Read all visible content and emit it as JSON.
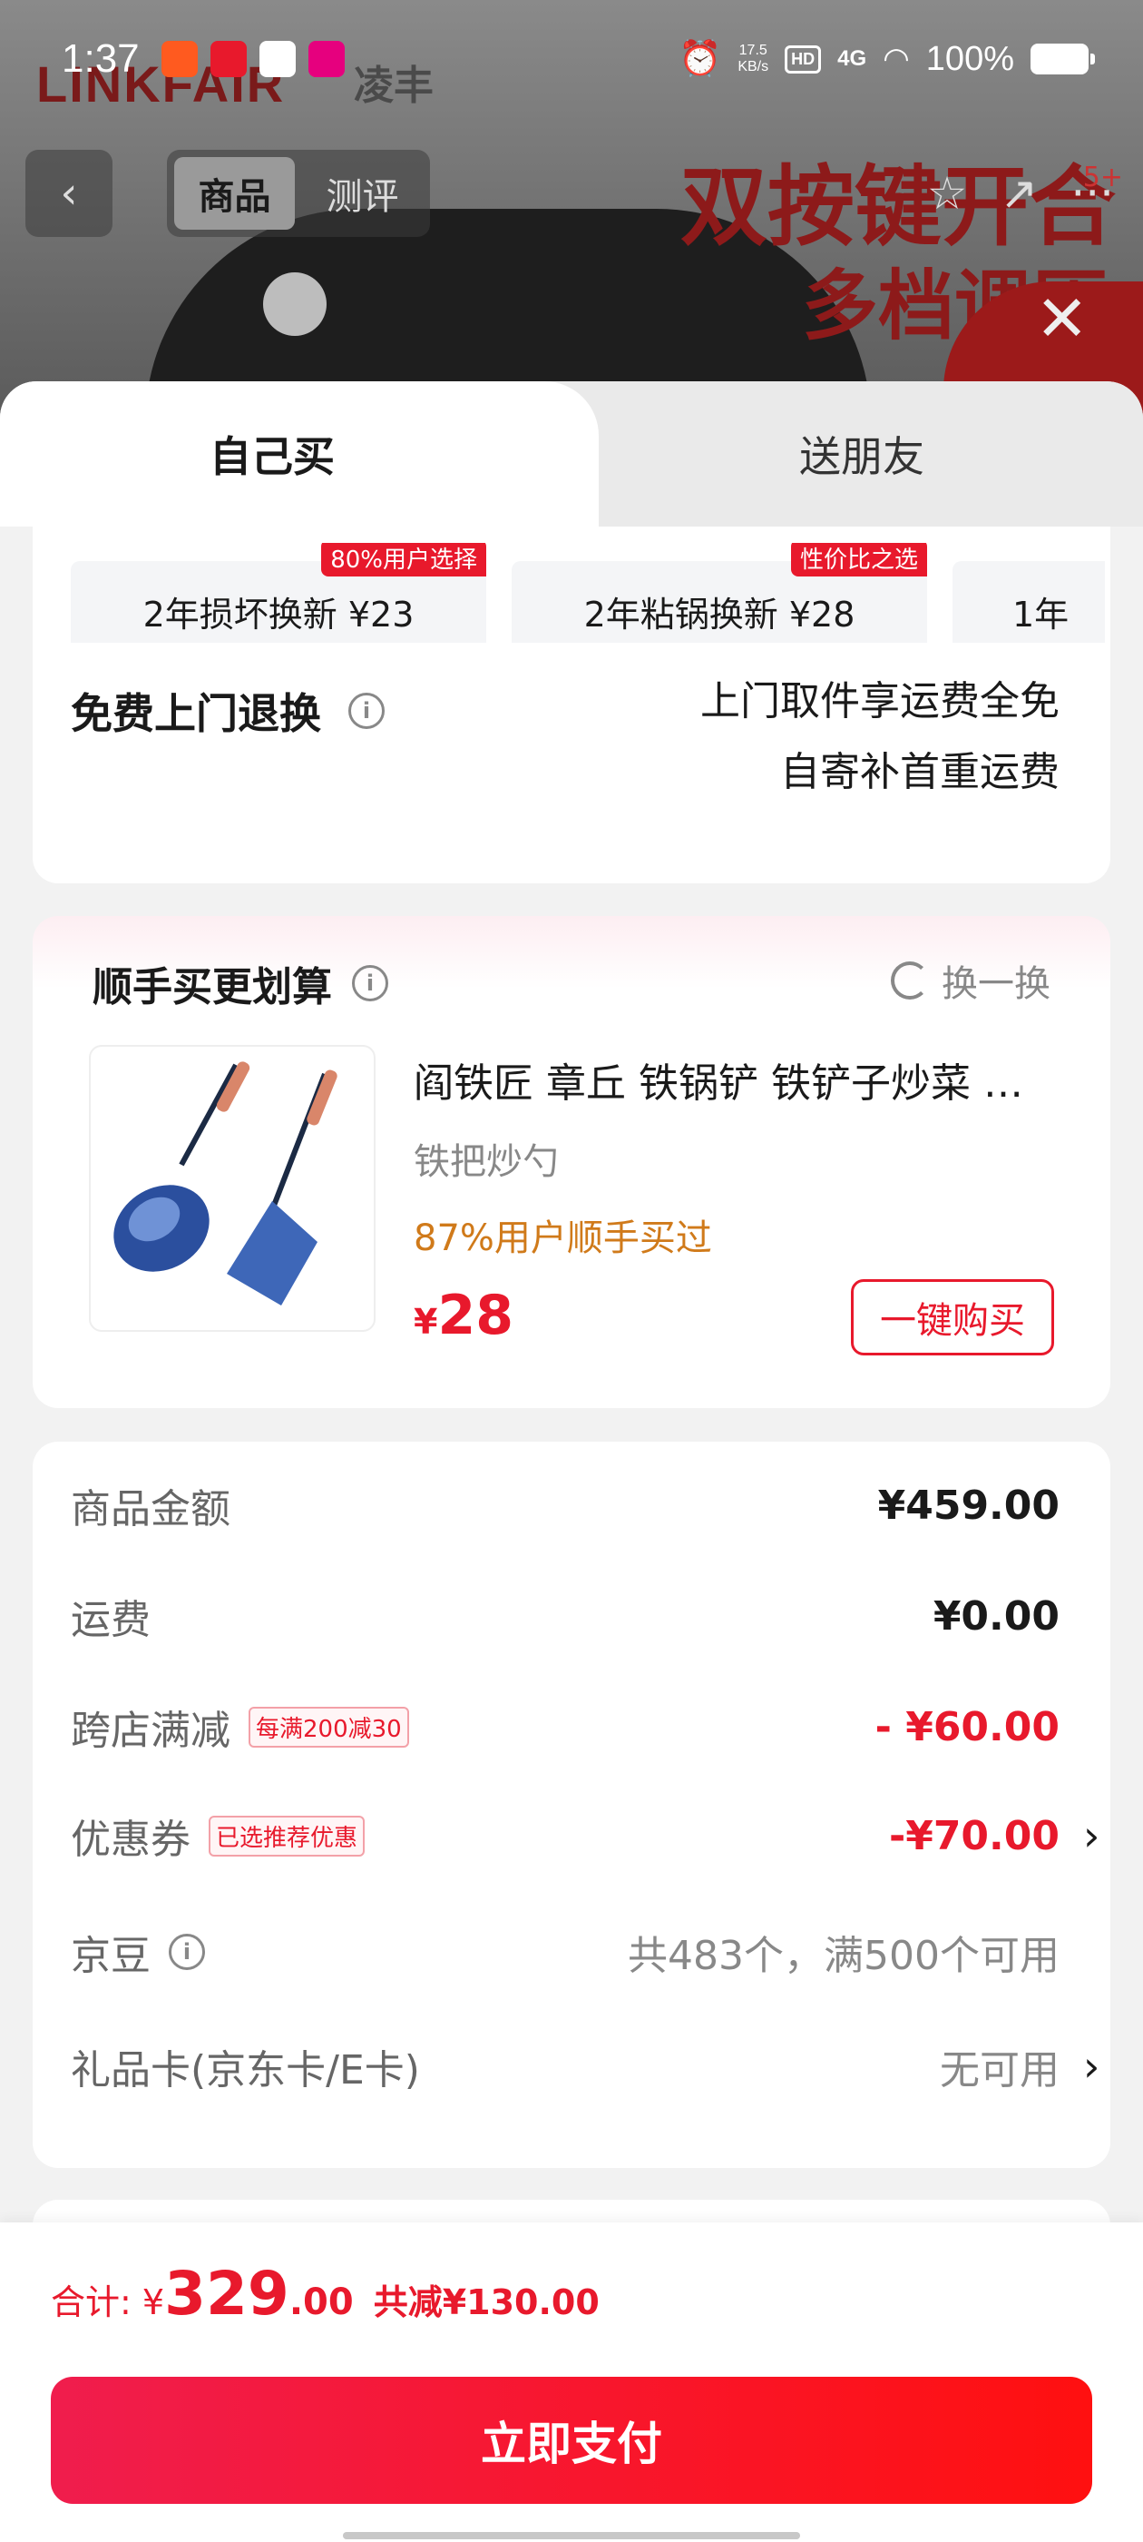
{
  "status_bar": {
    "time": "1:37",
    "net_speed_value": "17.5",
    "net_speed_unit": "KB/s",
    "hd": "HD",
    "network": "4G",
    "battery": "100%"
  },
  "background_page": {
    "brand": "LINKFAIR",
    "brand_cn": "凌丰",
    "headline_1": "双按键开合",
    "headline_2": "多档调压",
    "nav_tabs": [
      "商品",
      "测评"
    ],
    "cart_count": "5+"
  },
  "sheet": {
    "tabs": {
      "self": "自己买",
      "friend": "送朋友"
    },
    "protection_options": [
      {
        "label": "2年损坏换新  ¥23",
        "tag": "80%用户选择"
      },
      {
        "label": "2年粘锅换新  ¥28",
        "tag": "性价比之选"
      },
      {
        "label": "1年",
        "tag": ""
      }
    ],
    "free_return": {
      "title": "免费上门退换",
      "desc_line1": "上门取件享运费全免",
      "desc_line2": "自寄补首重运费"
    },
    "combo": {
      "title": "顺手买更划算",
      "swap_label": "换一换",
      "product_title": "阎铁匠 章丘 铁锅铲 铁铲子炒菜 铁把炒勺",
      "product_sub": "铁把炒勺",
      "product_hint": "87%用户顺手买过",
      "price_currency": "¥",
      "price": "28",
      "buy_label": "一键购买"
    },
    "fees": {
      "goods_label": "商品金额",
      "goods_value": "¥459.00",
      "shipping_label": "运费",
      "shipping_value": "¥0.00",
      "cross_store_label": "跨店满减",
      "cross_store_tag": "每满200减30",
      "cross_store_value": "- ¥60.00",
      "coupon_label": "优惠券",
      "coupon_tag": "已选推荐优惠",
      "coupon_value": "-¥70.00",
      "jingdou_label": "京豆",
      "jingdou_value": "共483个，满500个可用",
      "giftcard_label": "礼品卡(京东卡/E卡)",
      "giftcard_value": "无可用"
    },
    "footer": {
      "total_prefix": "合计: ¥",
      "total_int": "329",
      "total_dec": ".00",
      "saved": "共减¥130.00",
      "pay_label": "立即支付"
    }
  },
  "colors": {
    "accent_red": "#e8192c",
    "hint_orange": "#d07a1a"
  }
}
